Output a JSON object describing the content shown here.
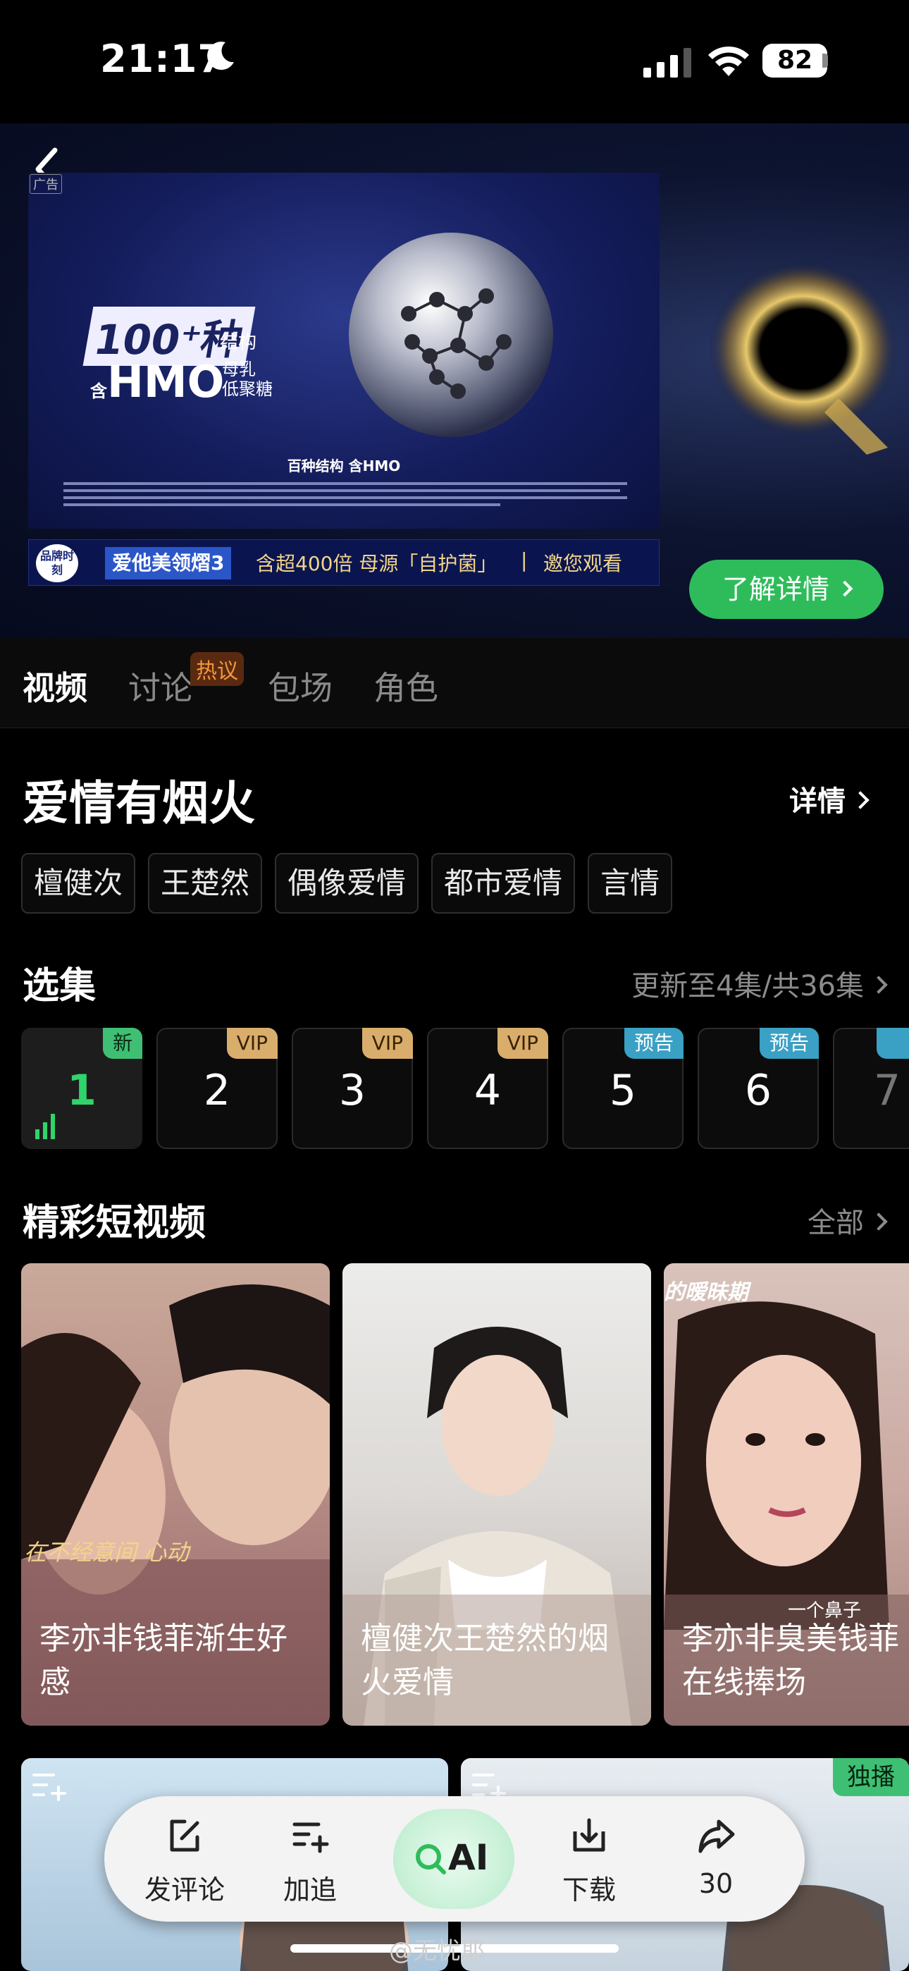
{
  "status_bar": {
    "time": "21:17",
    "battery": "82"
  },
  "ad": {
    "tag": "广告",
    "headline_count": "100⁺种",
    "headline_structure": "结构",
    "headline_contains": "含",
    "headline_hmo": "HMO",
    "headline_desc_line1": "母乳",
    "headline_desc_line2": "低聚糖",
    "caption": "百种结构 含HMO",
    "brand_badge": "品牌时刻",
    "product": "爱他美领熠3",
    "slogan": "含超400倍 母源「自护菌」",
    "divider": "|",
    "watch": "邀您观看",
    "cta": "了解详情"
  },
  "tabs": [
    {
      "label": "视频",
      "active": true
    },
    {
      "label": "讨论",
      "active": false
    },
    {
      "label": "包场",
      "active": false
    },
    {
      "label": "角色",
      "active": false
    }
  ],
  "hot_badge": "热议",
  "show": {
    "title": "爱情有烟火",
    "detail_label": "详情",
    "tags": [
      "檀健次",
      "王楚然",
      "偶像爱情",
      "都市爱情",
      "言情"
    ]
  },
  "episodes_section": {
    "title": "选集",
    "update_info": "更新至4集/共36集",
    "episodes": [
      {
        "number": "1",
        "badge": "新",
        "type": "new",
        "current": true
      },
      {
        "number": "2",
        "badge": "VIP",
        "type": "vip",
        "current": false
      },
      {
        "number": "3",
        "badge": "VIP",
        "type": "vip",
        "current": false
      },
      {
        "number": "4",
        "badge": "VIP",
        "type": "vip",
        "current": false
      },
      {
        "number": "5",
        "badge": "预告",
        "type": "trailer",
        "current": false
      },
      {
        "number": "6",
        "badge": "预告",
        "type": "trailer",
        "current": false
      },
      {
        "number": "7",
        "badge": "",
        "type": "trailer",
        "current": false
      }
    ]
  },
  "clips_section": {
    "title": "精彩短视频",
    "all_label": "全部",
    "clips": [
      {
        "title": "李亦非钱菲渐生好感",
        "overlay": "在不经意间 心动"
      },
      {
        "title": "檀健次王楚然的烟火爱情",
        "overlay": ""
      },
      {
        "title": "李亦非臭美钱菲在线捧场",
        "overlay": "的暧昧期",
        "overlay2": "一个鼻子"
      }
    ]
  },
  "bottom_cards": {
    "exclusive": "独播"
  },
  "action_bar": {
    "comment": "发评论",
    "follow": "加追",
    "ai": "AI",
    "download": "下载",
    "share": "30"
  },
  "watermark": "@无忧耶",
  "colors": {
    "accent_green": "#2ebc5b",
    "episode_current": "#2fd46a",
    "vip": "#d9ad6b",
    "trailer": "#3aa0c4"
  }
}
